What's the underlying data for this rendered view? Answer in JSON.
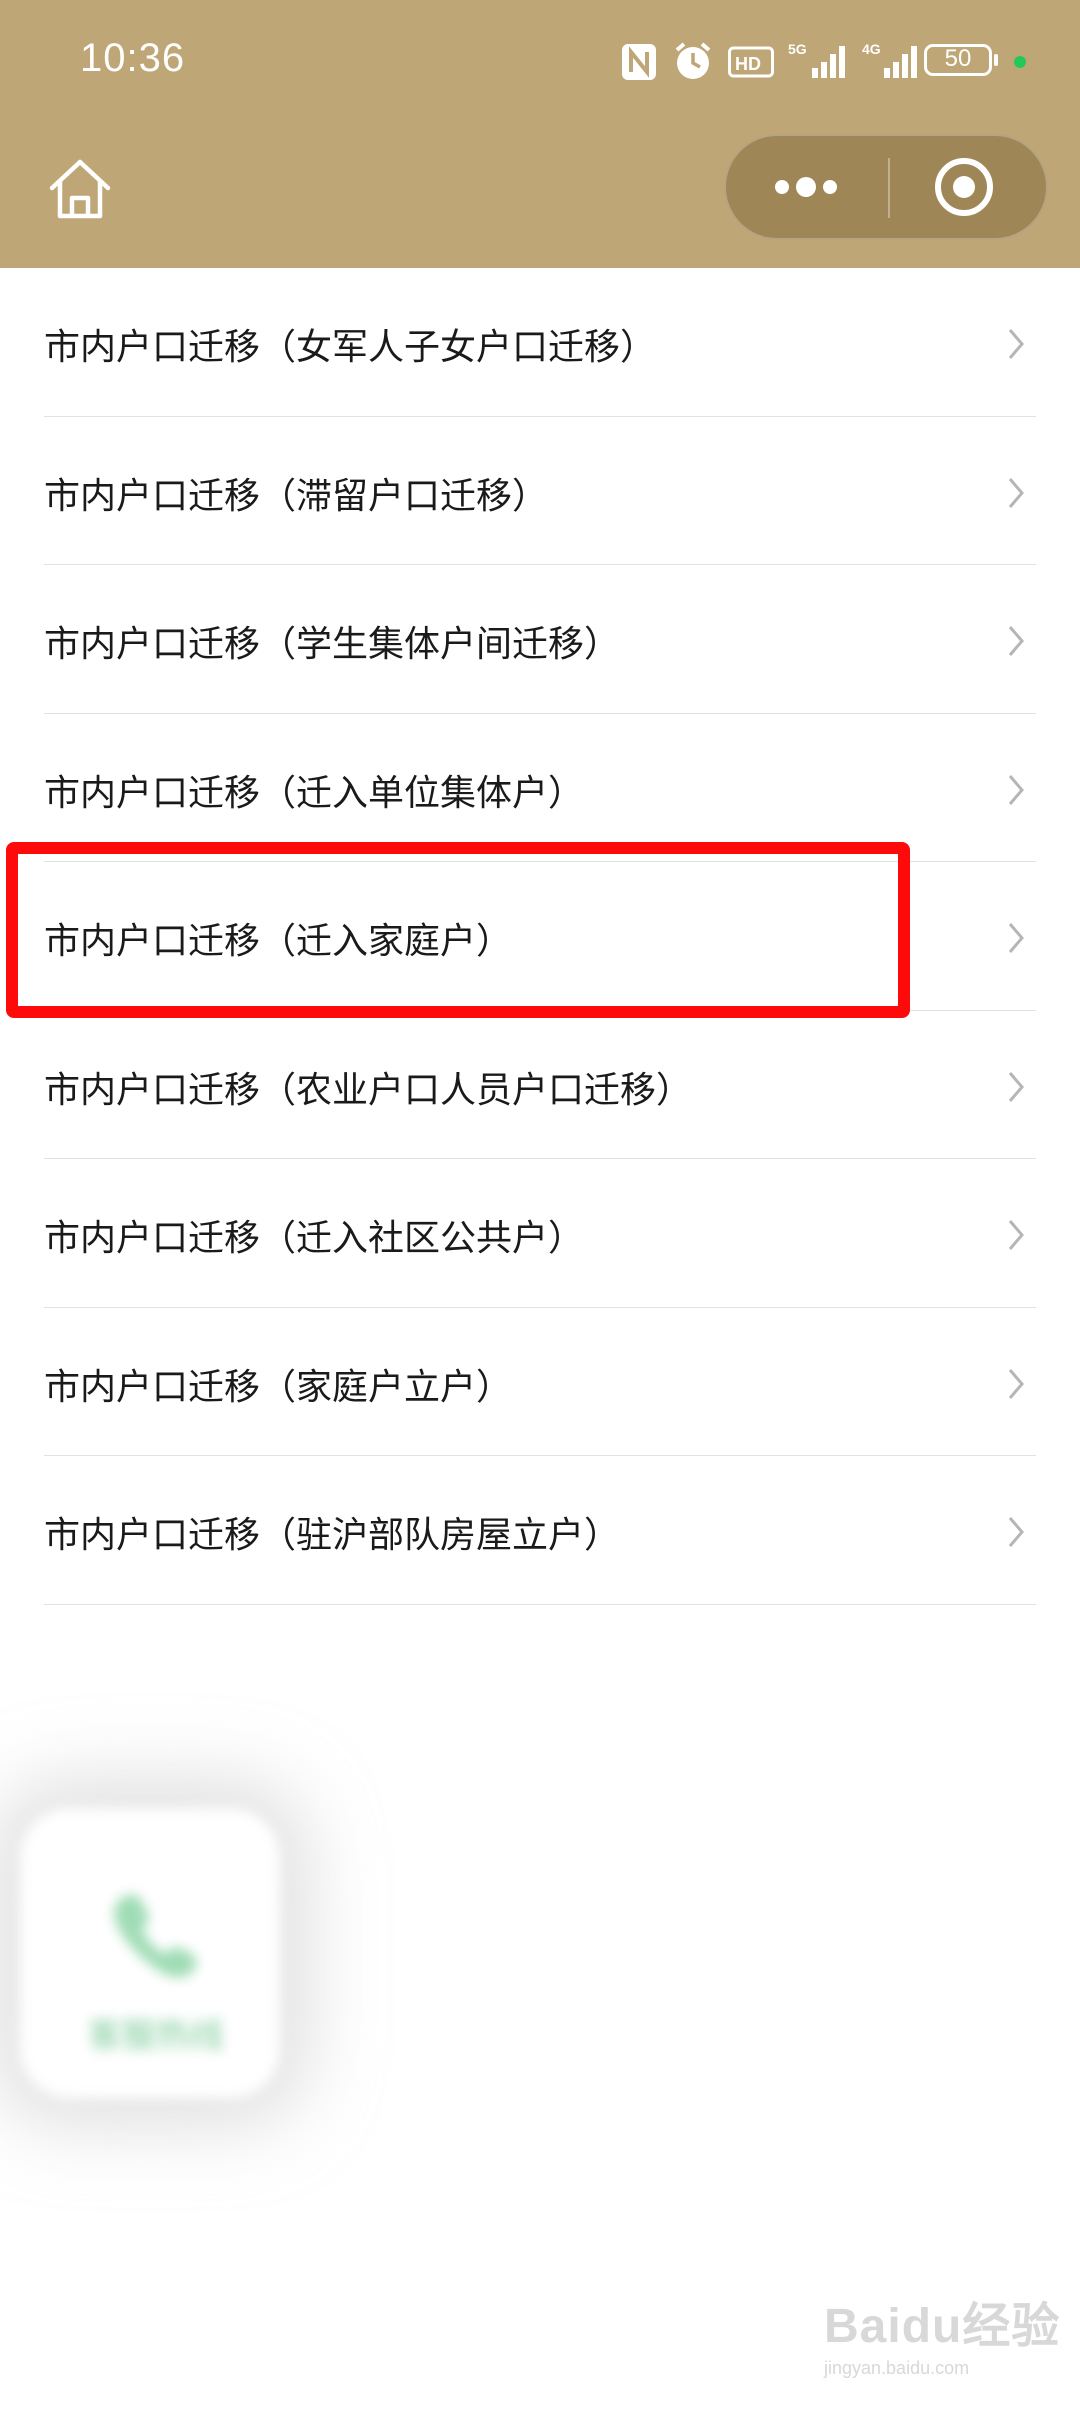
{
  "status_bar": {
    "time": "10:36",
    "battery": "50"
  },
  "header": {},
  "items": [
    {
      "label": "市内户口迁移（女军人子女户口迁移）"
    },
    {
      "label": "市内户口迁移（滞留户口迁移）"
    },
    {
      "label": "市内户口迁移（学生集体户间迁移）"
    },
    {
      "label": "市内户口迁移（迁入单位集体户）"
    },
    {
      "label": "市内户口迁移（迁入家庭户）"
    },
    {
      "label": "市内户口迁移（农业户口人员户口迁移）"
    },
    {
      "label": "市内户口迁移（迁入社区公共户）"
    },
    {
      "label": "市内户口迁移（家庭户立户）"
    },
    {
      "label": "市内户口迁移（驻沪部队房屋立户）"
    }
  ],
  "floating_button": {
    "label": "客服热线"
  },
  "watermark": {
    "logo": "Baidu经验",
    "url": "jingyan.baidu.com"
  },
  "colors": {
    "header": "#bea676",
    "highlight": "#ff0a0a",
    "accent_green": "#7ecb9a"
  }
}
